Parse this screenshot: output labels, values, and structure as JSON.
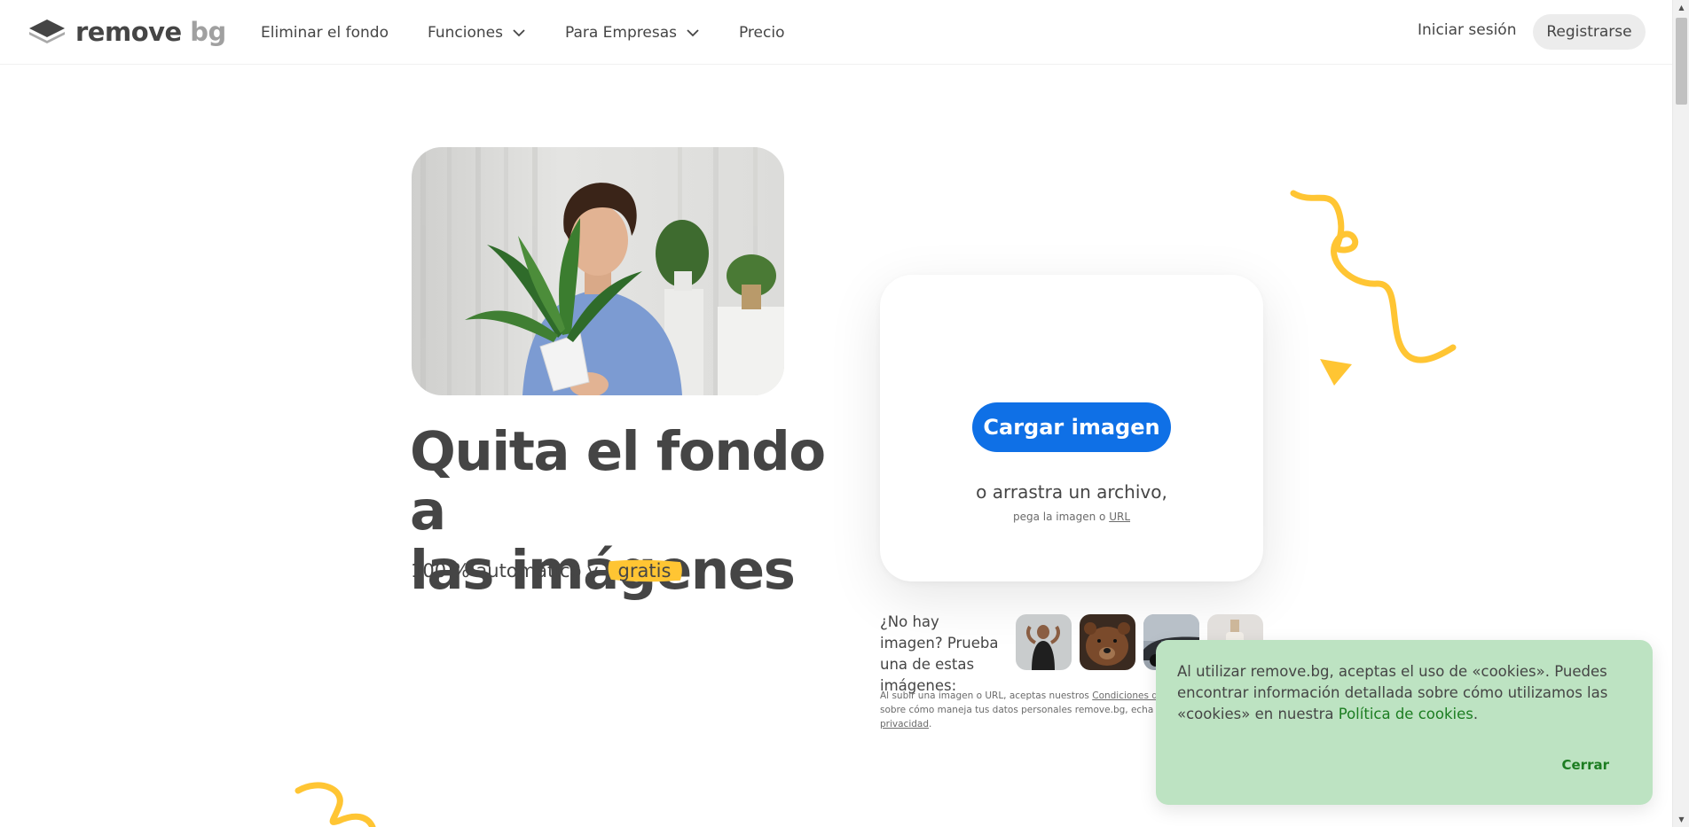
{
  "header": {
    "logo": {
      "word1": "remove",
      "word2": "bg"
    },
    "nav": [
      {
        "label": "Eliminar el fondo",
        "has_dropdown": false
      },
      {
        "label": "Funciones",
        "has_dropdown": true
      },
      {
        "label": "Para Empresas",
        "has_dropdown": true
      },
      {
        "label": "Precio",
        "has_dropdown": false
      }
    ],
    "login_label": "Iniciar sesión",
    "register_label": "Registrarse"
  },
  "hero": {
    "title_line1": "Quita el fondo a",
    "title_line2": "las imágenes",
    "subtitle": "100 % automático y",
    "highlight": "gratis"
  },
  "upload": {
    "button_label": "Cargar imagen",
    "drag_text": "o arrastra un archivo,",
    "paste_text": "pega la imagen o",
    "url_link": "URL"
  },
  "samples": {
    "prompt": "¿No hay imagen? Prueba una de estas imágenes:",
    "items": [
      "woman-flexing",
      "bear",
      "car",
      "product-bottle"
    ]
  },
  "legal": {
    "text_before": "Al subir una imagen o URL, aceptas nuestros",
    "terms_link": "Condiciones del serv",
    "text_middle": "sobre cómo maneja tus datos personales remove.bg, echa un vist",
    "privacy_link": "privacidad",
    "text_end": "."
  },
  "cookie": {
    "text": "Al utilizar remove.bg, aceptas el uso de «cookies». Puedes encontrar información detallada sobre cómo utilizamos las «cookies» en nuestra",
    "policy_link": "Política de cookies",
    "text_end": ".",
    "close_label": "Cerrar"
  },
  "colors": {
    "primary_blue": "#0f70e6",
    "text_dark": "#454545",
    "accent_yellow": "#ffc533",
    "cookie_bg": "#bde3c2",
    "cookie_link": "#1c7d21"
  }
}
